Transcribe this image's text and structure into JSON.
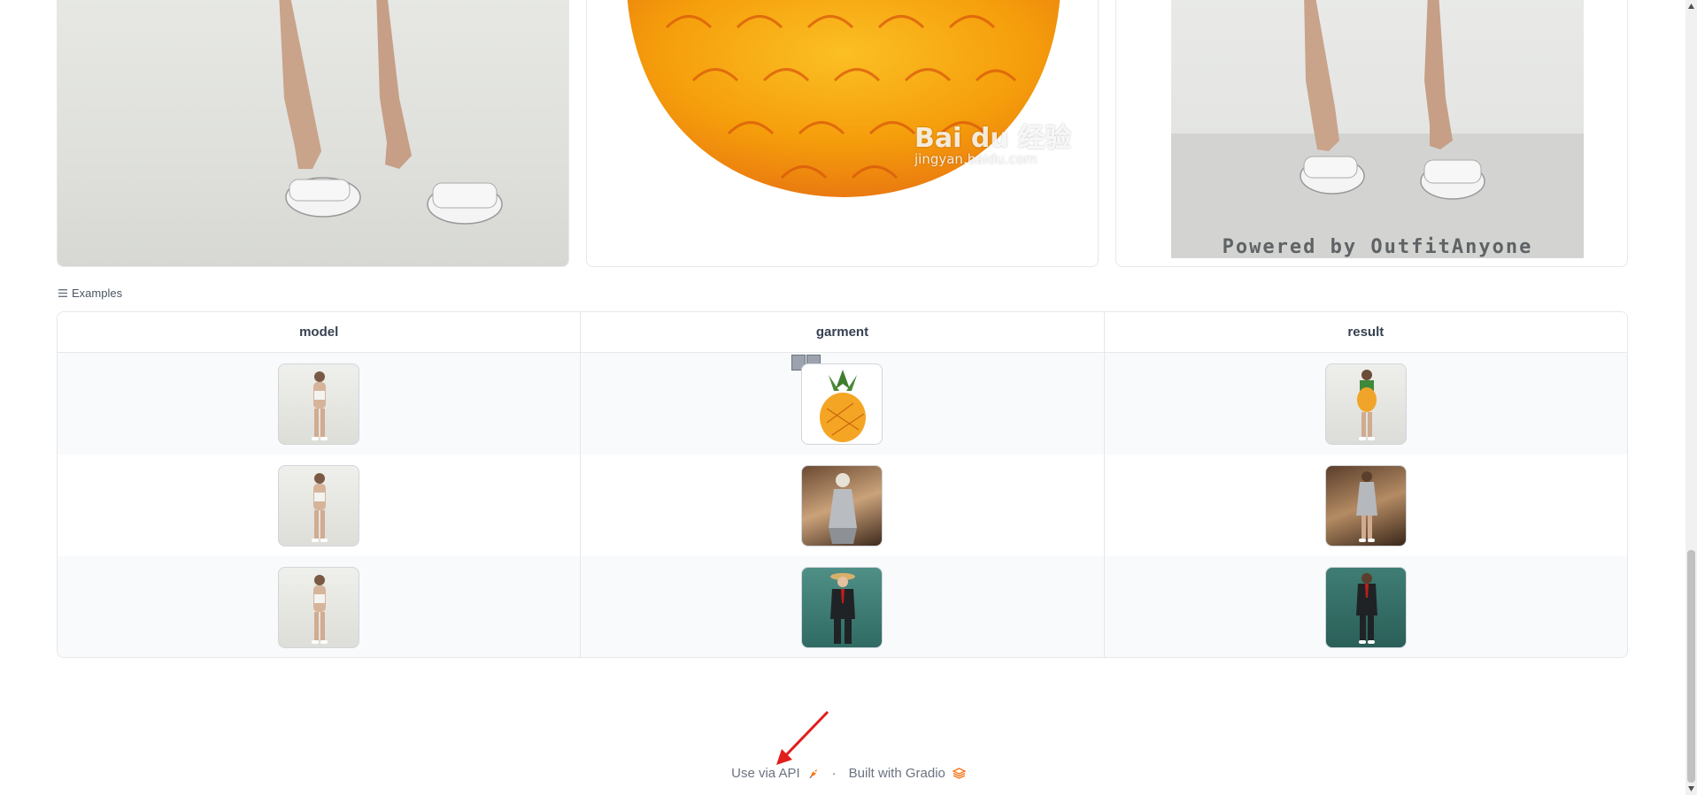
{
  "panels": {
    "result_caption": "Powered by OutfitAnyone",
    "watermark_main": "Bai du 经验",
    "watermark_sub": "jingyan.baidu.com"
  },
  "examples": {
    "label": "Examples",
    "columns": [
      "model",
      "garment",
      "result"
    ],
    "rows": [
      {
        "model": "model-photo",
        "garment": "pineapple",
        "result": "model-in-pineapple"
      },
      {
        "model": "model-photo",
        "garment": "silver-dress-figure",
        "result": "model-in-silver-dress"
      },
      {
        "model": "model-photo",
        "garment": "suit-figure",
        "result": "model-in-suit"
      }
    ]
  },
  "footer": {
    "api_link": "Use via API",
    "separator": "·",
    "built_with": "Built with Gradio"
  },
  "colors": {
    "annotation_arrow": "#e11d1d",
    "gradio_logo": "#f97316"
  }
}
